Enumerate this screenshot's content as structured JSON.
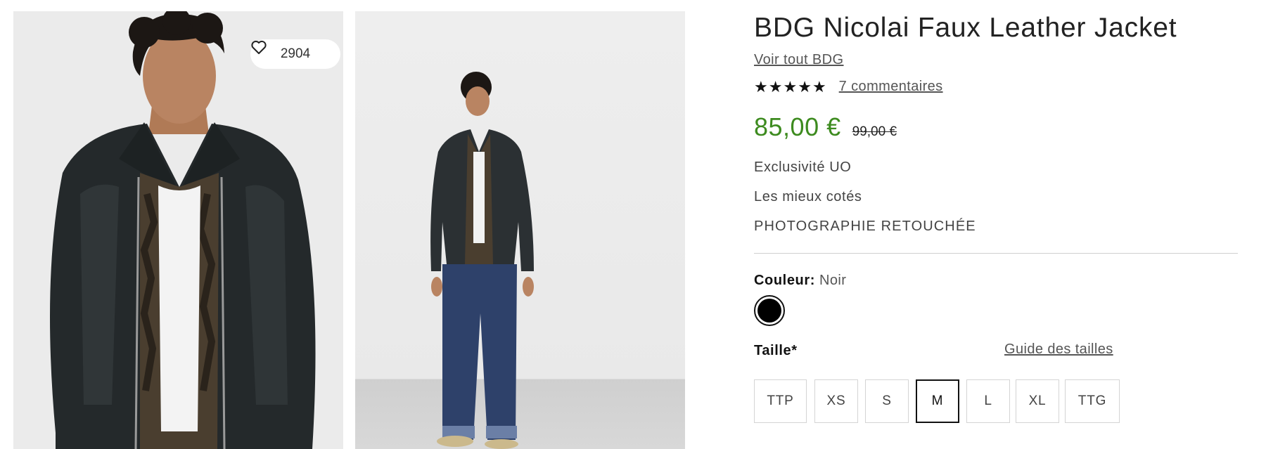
{
  "gallery": {
    "favorites_count": "2904",
    "images": [
      {
        "icon": "model-closeup-photo"
      },
      {
        "icon": "model-full-body-photo"
      }
    ]
  },
  "product": {
    "title": "BDG Nicolai Faux Leather Jacket",
    "brand_link": "Voir tout BDG",
    "rating": {
      "stars": 5,
      "star_glyph": "★",
      "reviews_label": "7 commentaires"
    },
    "price": {
      "current": "85,00 €",
      "original": "99,00 €",
      "current_color": "#3d8b1f"
    },
    "tags": [
      "Exclusivité UO",
      "Les mieux cotés",
      "PHOTOGRAPHIE RETOUCHÉE"
    ]
  },
  "color": {
    "label": "Couleur:",
    "value": "Noir",
    "swatch_hex": "#000000"
  },
  "size": {
    "label": "Taille*",
    "guide_label": "Guide des tailles",
    "options": [
      "TTP",
      "XS",
      "S",
      "M",
      "L",
      "XL",
      "TTG"
    ],
    "selected": "M"
  }
}
